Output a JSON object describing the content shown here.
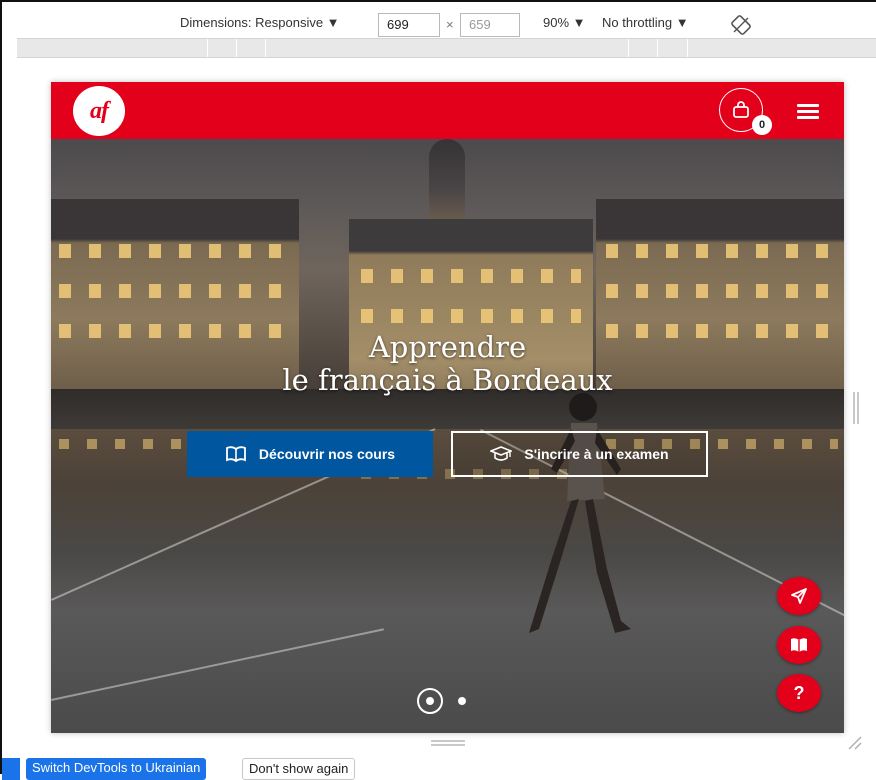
{
  "devtools": {
    "dimensions_label": "Dimensions: Responsive ▼",
    "width_value": "699",
    "times_sign": "×",
    "height_value": "659",
    "zoom_label": "90% ▼",
    "throttling_label": "No throttling ▼",
    "rotate_icon": "rotate-icon"
  },
  "site": {
    "logo_text": "af",
    "cart_count": "0",
    "brand_color": "#e2001a",
    "primary_color": "#00579f"
  },
  "hero": {
    "title_line1": "Apprendre",
    "title_line2": "le français à Bordeaux",
    "btn_courses": "Découvrir nos cours",
    "btn_exam": "S'incrire à un examen",
    "fab_help": "?",
    "slides": {
      "active": 1,
      "count": 2
    }
  },
  "infobar": {
    "switch_label": "Switch DevTools to Ukrainian",
    "dismiss_label": "Don't show again"
  }
}
